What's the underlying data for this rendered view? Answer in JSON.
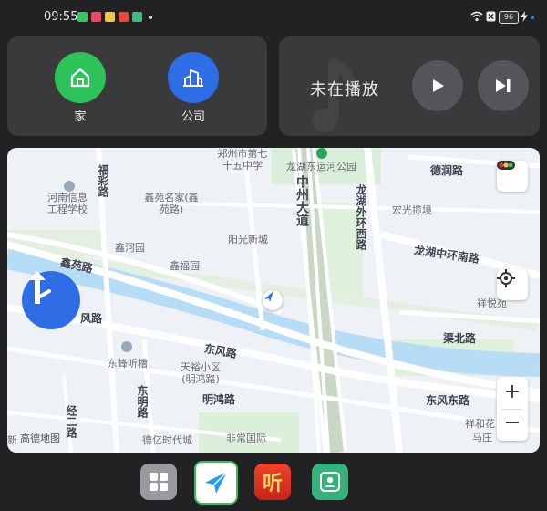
{
  "status_bar": {
    "time": "09:55",
    "battery": "96",
    "notification_icons": [
      "wechat-icon",
      "message-icon",
      "folder-icon",
      "note-icon",
      "shield-icon"
    ]
  },
  "shortcuts": {
    "home": {
      "label": "家",
      "color": "#2ec25a",
      "icon": "home-icon"
    },
    "company": {
      "label": "公司",
      "color": "#2f6de6",
      "icon": "building-icon"
    }
  },
  "media": {
    "title": "未在播放",
    "play_icon": "play-icon",
    "next_icon": "skip-next-icon"
  },
  "map": {
    "labels": {
      "zhengzhou_school": "郑州市第七十五中学",
      "canal_park": "龙湖东运河公园",
      "derun_road": "德润路",
      "fucai_road": "福彩路",
      "henan_it_school": "河南信息工程学校",
      "xinyuan_mingjia": "鑫苑名家(鑫苑路)",
      "zhongzhou_avenue": "中州大道",
      "longhu_outer_west": "龙湖外环西路",
      "hongguang_jing": "宏光揽境",
      "yangguang_xincheng": "阳光新城",
      "xinhe_yuan": "鑫河园",
      "xinfu_yuan": "鑫福园",
      "longhu_middle_south": "龙湖中环南路",
      "xinyuan_road": "鑫苑路",
      "xiangyue_yuan": "祥悦苑",
      "dongfeng_road_w": "风路",
      "qu_bei_road": "渠北路",
      "dongfeng_road": "东风路",
      "dongfeng_tingtao": "东峰听槽",
      "tianyu_xiaoqu": "天裕小区(明鸿路)",
      "dongming_road": "东明路",
      "minghong_road": "明鸿路",
      "dongfeng_east_road": "东风东路",
      "jing_er_road": "经二路",
      "xianghe_huayuan": "祥和花",
      "mazhuang": "马庄",
      "deyi_times_city": "德亿时代城",
      "feichang_guoji": "非常国际",
      "xin_label": "新"
    },
    "watermark": "高德地图",
    "icons": {
      "traffic": "traffic-light-icon",
      "locate": "locate-icon",
      "nav": "turn-arrow-icon"
    },
    "zoom_in": "+",
    "zoom_out": "−"
  },
  "dock": {
    "apps": [
      {
        "name": "app-grid-icon",
        "color": "#9a9a9e"
      },
      {
        "name": "amap-navigation-icon",
        "color": "#1f9bf0"
      },
      {
        "name": "ting-audio-icon",
        "color": "#e8341e"
      },
      {
        "name": "contacts-icon",
        "color": "#35b27a"
      }
    ],
    "ting_label": "听"
  }
}
